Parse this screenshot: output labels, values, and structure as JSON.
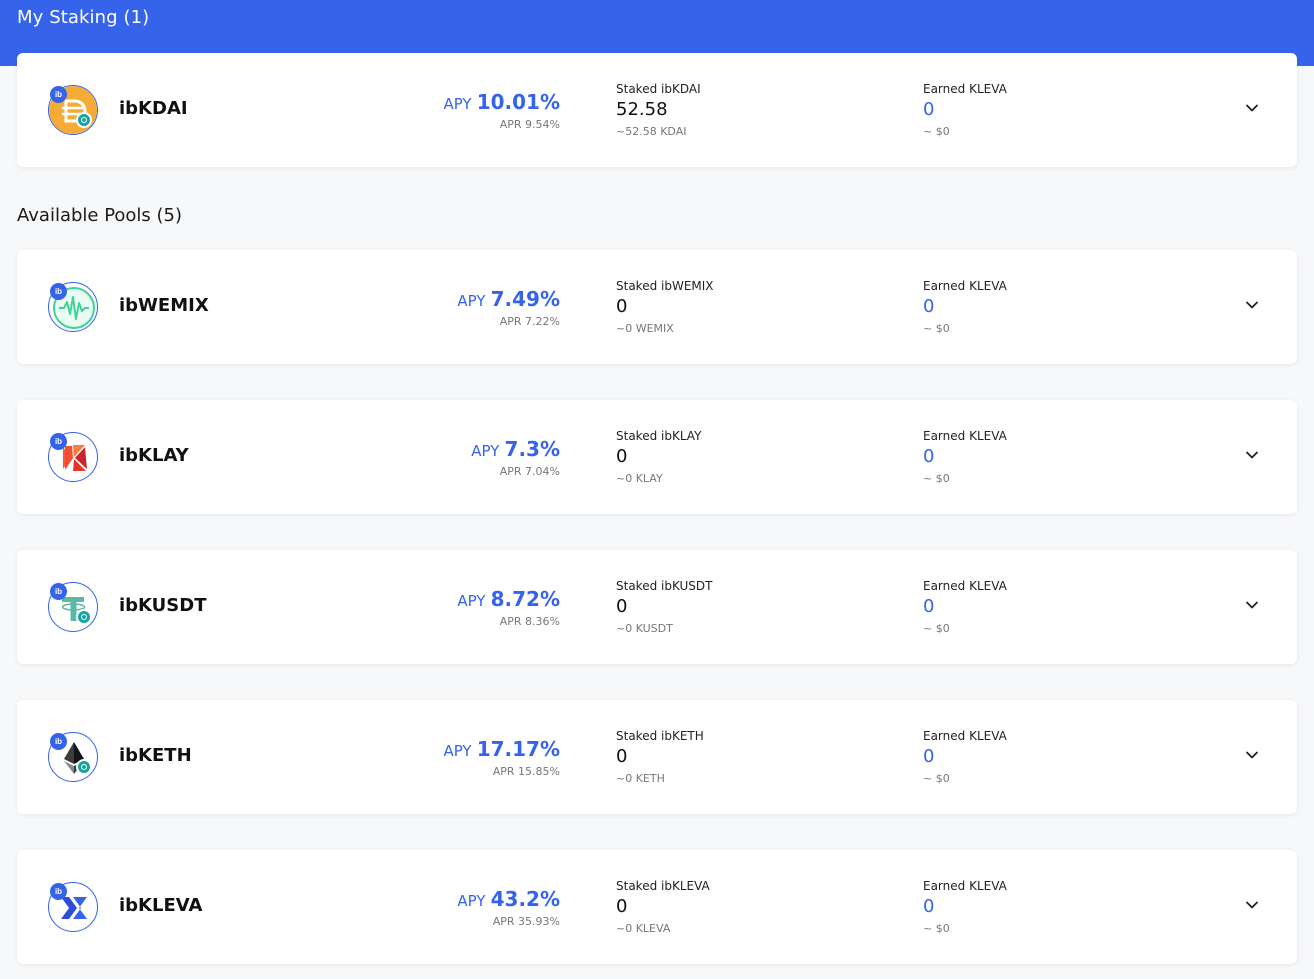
{
  "my_staking": {
    "title": "My Staking (1)",
    "pools": [
      {
        "name": "ibKDAI",
        "ib_label": "ib",
        "icon": "dai-icon",
        "apy_label": "APY",
        "apy": "10.01%",
        "apr": "APR 9.54%",
        "staked_label": "Staked ibKDAI",
        "staked_value": "52.58",
        "staked_sub": "~52.58 KDAI",
        "earned_label": "Earned KLEVA",
        "earned_value": "0",
        "earned_sub": "~ $0"
      }
    ]
  },
  "available": {
    "title": "Available Pools (5)",
    "pools": [
      {
        "name": "ibWEMIX",
        "ib_label": "ib",
        "icon": "wemix-icon",
        "apy_label": "APY",
        "apy": "7.49%",
        "apr": "APR 7.22%",
        "staked_label": "Staked ibWEMIX",
        "staked_value": "0",
        "staked_sub": "~0 WEMIX",
        "earned_label": "Earned KLEVA",
        "earned_value": "0",
        "earned_sub": "~ $0"
      },
      {
        "name": "ibKLAY",
        "ib_label": "ib",
        "icon": "klay-icon",
        "apy_label": "APY",
        "apy": "7.3%",
        "apr": "APR 7.04%",
        "staked_label": "Staked ibKLAY",
        "staked_value": "0",
        "staked_sub": "~0 KLAY",
        "earned_label": "Earned KLEVA",
        "earned_value": "0",
        "earned_sub": "~ $0"
      },
      {
        "name": "ibKUSDT",
        "ib_label": "ib",
        "icon": "tether-icon",
        "apy_label": "APY",
        "apy": "8.72%",
        "apr": "APR 8.36%",
        "staked_label": "Staked ibKUSDT",
        "staked_value": "0",
        "staked_sub": "~0 KUSDT",
        "earned_label": "Earned KLEVA",
        "earned_value": "0",
        "earned_sub": "~ $0"
      },
      {
        "name": "ibKETH",
        "ib_label": "ib",
        "icon": "ethereum-icon",
        "apy_label": "APY",
        "apy": "17.17%",
        "apr": "APR 15.85%",
        "staked_label": "Staked ibKETH",
        "staked_value": "0",
        "staked_sub": "~0 KETH",
        "earned_label": "Earned KLEVA",
        "earned_value": "0",
        "earned_sub": "~ $0"
      },
      {
        "name": "ibKLEVA",
        "ib_label": "ib",
        "icon": "kleva-icon",
        "apy_label": "APY",
        "apy": "43.2%",
        "apr": "APR 35.93%",
        "staked_label": "Staked ibKLEVA",
        "staked_value": "0",
        "staked_sub": "~0 KLEVA",
        "earned_label": "Earned KLEVA",
        "earned_value": "0",
        "earned_sub": "~ $0"
      }
    ]
  },
  "colors": {
    "accent": "#3563e9",
    "background": "#f7f8fa",
    "card": "#ffffff",
    "muted_text": "#777777"
  }
}
